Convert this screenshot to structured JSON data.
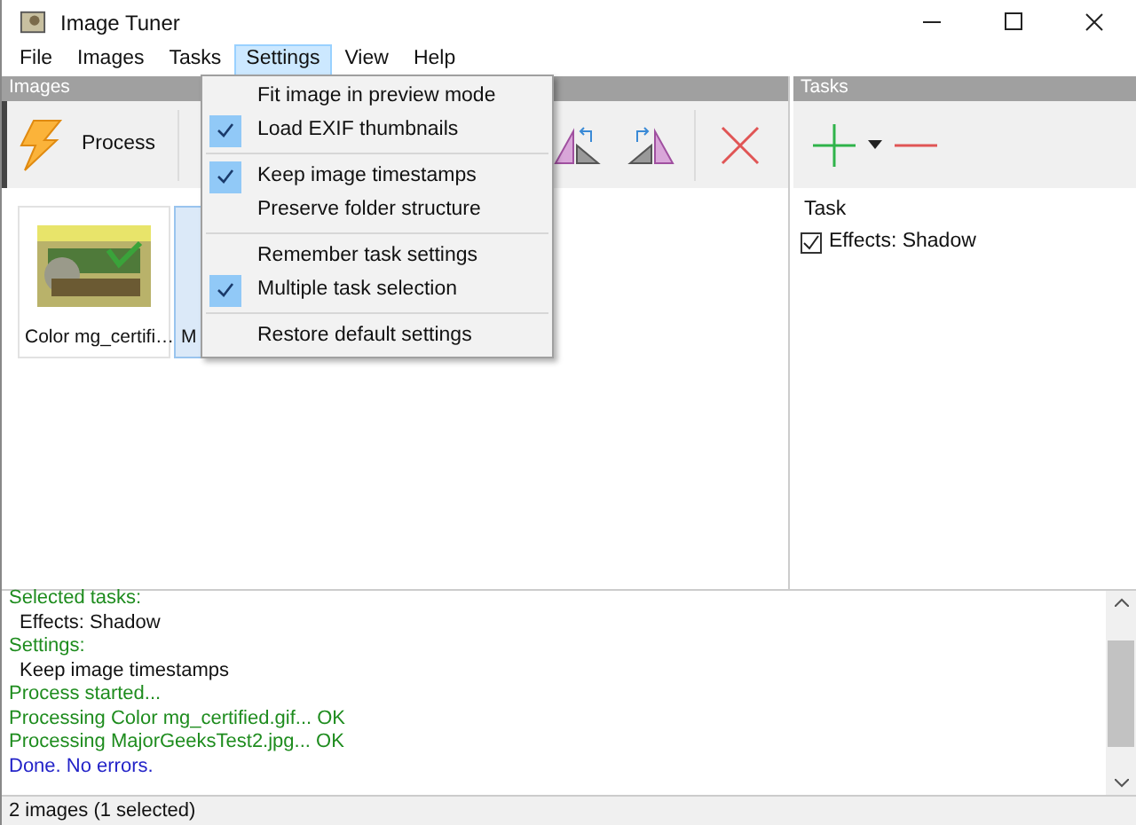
{
  "window": {
    "title": "Image Tuner"
  },
  "menu_bar": [
    {
      "label": "File",
      "selected": false
    },
    {
      "label": "Images",
      "selected": false
    },
    {
      "label": "Tasks",
      "selected": false
    },
    {
      "label": "Settings",
      "selected": true
    },
    {
      "label": "View",
      "selected": false
    },
    {
      "label": "Help",
      "selected": false
    }
  ],
  "settings_menu": [
    [
      {
        "label": "Fit image in preview mode",
        "checked": false
      },
      {
        "label": "Load EXIF thumbnails",
        "checked": true
      }
    ],
    [
      {
        "label": "Keep image timestamps",
        "checked": true
      },
      {
        "label": "Preserve folder structure",
        "checked": false
      }
    ],
    [
      {
        "label": "Remember task settings",
        "checked": false
      },
      {
        "label": "Multiple task selection",
        "checked": true
      }
    ],
    [
      {
        "label": "Restore default settings",
        "checked": false
      }
    ]
  ],
  "images_panel": {
    "title": "Images",
    "process_button": "Process",
    "thumbnails": [
      {
        "label": "Color mg_certifi…",
        "selected": false
      },
      {
        "label": "M",
        "selected": true
      }
    ]
  },
  "tasks_panel": {
    "title": "Tasks",
    "column": "Task",
    "tasks": [
      {
        "label": "Effects: Shadow",
        "checked": true
      }
    ]
  },
  "log": [
    {
      "kind": "heading",
      "text": "Selected tasks:"
    },
    {
      "kind": "item",
      "text": "Effects: Shadow"
    },
    {
      "kind": "heading",
      "text": "Settings:"
    },
    {
      "kind": "item",
      "text": "Keep image timestamps"
    },
    {
      "kind": "heading",
      "text": "Process started..."
    },
    {
      "kind": "heading",
      "text": "Processing Color mg_certified.gif... OK"
    },
    {
      "kind": "heading",
      "text": "Processing MajorGeeksTest2.jpg... OK"
    },
    {
      "kind": "done",
      "text": "Done. No errors."
    }
  ],
  "status_bar": "2 images (1 selected)"
}
